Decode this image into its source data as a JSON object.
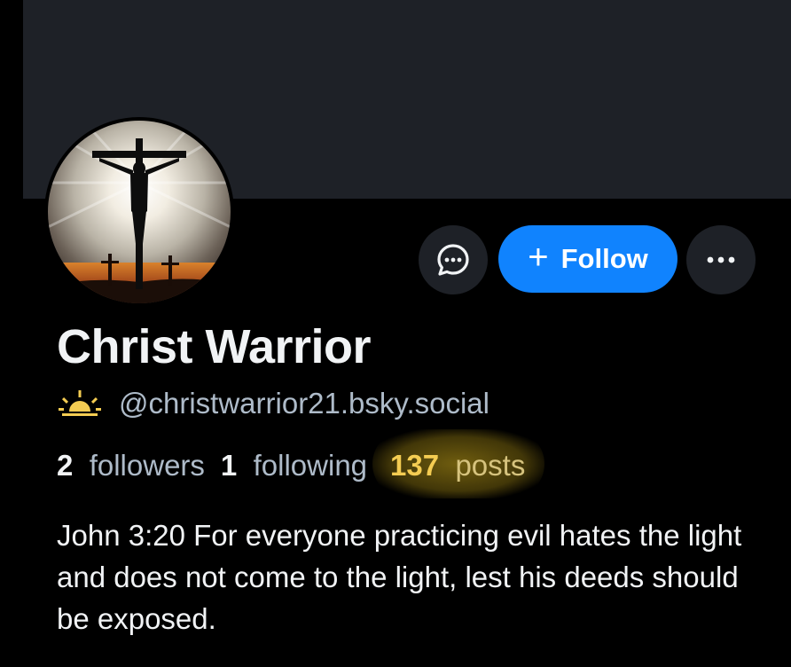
{
  "profile": {
    "display_name": "Christ Warrior",
    "handle": "@christwarrior21.bsky.social",
    "bio": "John 3:20 For everyone practicing evil hates the light and does not come to the light, lest his deeds should be exposed."
  },
  "actions": {
    "follow_label": "Follow",
    "follow_plus": "+"
  },
  "stats": {
    "followers_count": "2",
    "followers_label": "followers",
    "following_count": "1",
    "following_label": "following",
    "posts_count": "137",
    "posts_label": "posts"
  },
  "icons": {
    "message": "chat-bubble-icon",
    "more": "ellipsis-icon",
    "status": "sunrise-icon",
    "avatar": "crucifix-avatar"
  },
  "colors": {
    "background": "#000000",
    "banner": "#1e2127",
    "accent": "#1083fe",
    "secondary_text": "#aebbc9",
    "highlight": "#f4cc52"
  }
}
